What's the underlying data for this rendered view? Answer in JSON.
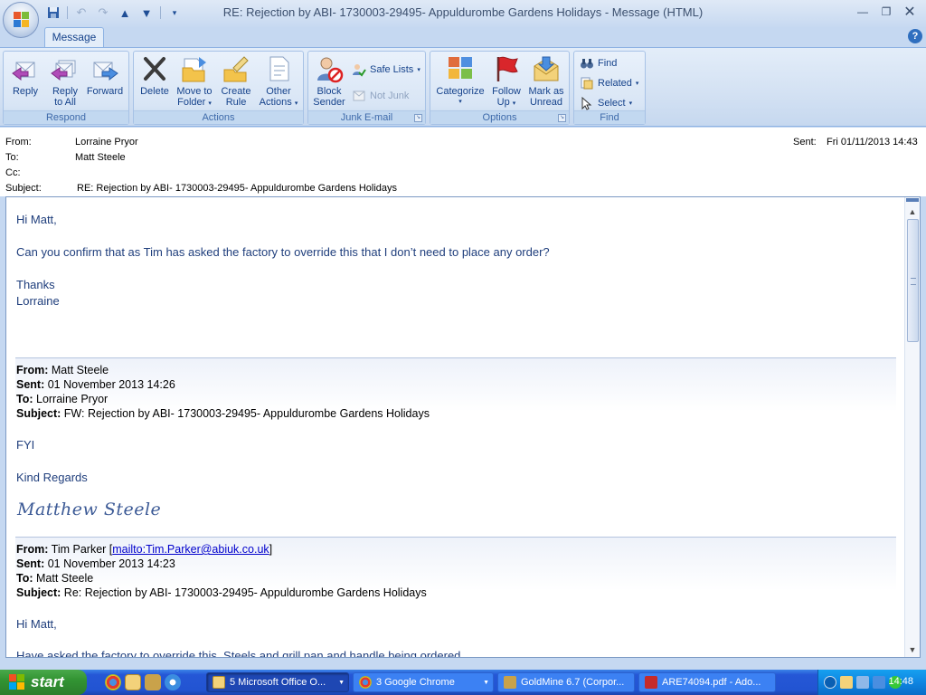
{
  "window": {
    "title": "RE: Rejection by ABI- 1730003-29495- Appuldurombe Gardens Holidays - Message (HTML)"
  },
  "ribbon": {
    "tab": "Message",
    "groups": {
      "respond": {
        "label": "Respond",
        "reply": "Reply",
        "reply_all_1": "Reply",
        "reply_all_2": "to All",
        "forward": "Forward"
      },
      "actions": {
        "label": "Actions",
        "delete": "Delete",
        "move_1": "Move to",
        "move_2": "Folder",
        "create_1": "Create",
        "create_2": "Rule",
        "other_1": "Other",
        "other_2": "Actions"
      },
      "junk": {
        "label": "Junk E-mail",
        "block_1": "Block",
        "block_2": "Sender",
        "safe_lists": "Safe Lists",
        "not_junk": "Not Junk"
      },
      "options": {
        "label": "Options",
        "categorize": "Categorize",
        "follow_1": "Follow",
        "follow_2": "Up",
        "mark_1": "Mark as",
        "mark_2": "Unread"
      },
      "find": {
        "label": "Find",
        "find": "Find",
        "related": "Related",
        "select": "Select"
      }
    }
  },
  "header": {
    "from_label": "From:",
    "from": "Lorraine Pryor",
    "to_label": "To:",
    "to": "Matt Steele",
    "cc_label": "Cc:",
    "cc": "",
    "subject_label": "Subject:",
    "subject": "RE: Rejection by ABI- 1730003-29495- Appuldurombe Gardens Holidays",
    "sent_label": "Sent:",
    "sent": "Fri 01/11/2013 14:43"
  },
  "body": {
    "greeting": "Hi Matt,",
    "line1": "Can you confirm that as Tim has asked the factory to override this that I don’t need to place any order?",
    "thanks": "Thanks",
    "sender": "Lorraine",
    "quote1": {
      "from_label": "From:",
      "from": " Matt Steele",
      "sent_label": "Sent:",
      "sent": " 01 November 2013 14:26",
      "to_label": "To:",
      "to": " Lorraine Pryor",
      "subject_label": "Subject:",
      "subject": " FW: Rejection by ABI- 1730003-29495- Appuldurombe Gardens Holidays",
      "fyi": "FYI",
      "regards": "Kind Regards",
      "signature": "Matthew Steele"
    },
    "quote2": {
      "from_label": "From:",
      "from": " Tim Parker [",
      "from_link": "mailto:Tim.Parker@abiuk.co.uk",
      "from_end": "]",
      "sent_label": "Sent:",
      "sent": " 01 November 2013 14:23",
      "to_label": "To:",
      "to": " Matt Steele",
      "subject_label": "Subject:",
      "subject": " Re: Rejection by ABI- 1730003-29495- Appuldurombe Gardens Holidays",
      "greeting": "Hi Matt,",
      "line1": "Have asked the factory to override this. Steels and grill pan and handle being ordered"
    }
  },
  "taskbar": {
    "start": "start",
    "tasks": [
      {
        "label": "5 Microsoft Office O...",
        "icon": "outlook-icon"
      },
      {
        "label": "3 Google Chrome",
        "icon": "chrome-icon"
      },
      {
        "label": "GoldMine 6.7 (Corpor...",
        "icon": "goldmine-icon"
      },
      {
        "label": "ARE74094.pdf - Ado...",
        "icon": "pdf-icon"
      }
    ],
    "clock": "14:48"
  },
  "colors": {
    "accent": "#15428b",
    "taskbar": "#2254d2",
    "start": "#329433"
  }
}
